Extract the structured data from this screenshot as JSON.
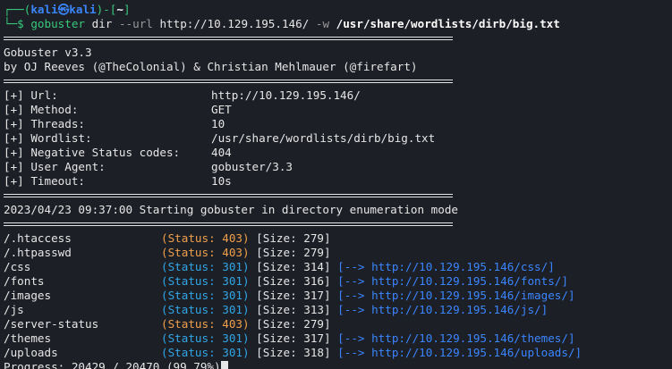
{
  "prompt": {
    "top_prefix": "┌──(",
    "user": "kali",
    "at": "㉿",
    "host": "kali",
    "mid": ")-[",
    "dir": "~",
    "close": "]",
    "bottom_prefix": "└─$",
    "cmd": "gobuster",
    "arg_dir": "dir",
    "flag_url": "--url",
    "url": "http://10.129.195.146/",
    "flag_w": "-w",
    "wordlist": "/usr/share/wordlists/dirb/big.txt"
  },
  "banner": {
    "title": "Gobuster v3.3",
    "authors": "by OJ Reeves (@TheColonial) & Christian Mehlmauer (@firefart)"
  },
  "config": [
    {
      "key": "[+] Url:",
      "value": "http://10.129.195.146/"
    },
    {
      "key": "[+] Method:",
      "value": "GET"
    },
    {
      "key": "[+] Threads:",
      "value": "10"
    },
    {
      "key": "[+] Wordlist:",
      "value": "/usr/share/wordlists/dirb/big.txt"
    },
    {
      "key": "[+] Negative Status codes:",
      "value": "404"
    },
    {
      "key": "[+] User Agent:",
      "value": "gobuster/3.3"
    },
    {
      "key": "[+] Timeout:",
      "value": "10s"
    }
  ],
  "start_message": "2023/04/23 09:37:00 Starting gobuster in directory enumeration mode",
  "results": [
    {
      "path": "/.htaccess",
      "status": "(Status: 403)",
      "size": "[Size: 279]",
      "redirect": ""
    },
    {
      "path": "/.htpasswd",
      "status": "(Status: 403)",
      "size": "[Size: 279]",
      "redirect": ""
    },
    {
      "path": "/css",
      "status": "(Status: 301)",
      "size": "[Size: 314]",
      "redirect": "[--> http://10.129.195.146/css/]"
    },
    {
      "path": "/fonts",
      "status": "(Status: 301)",
      "size": "[Size: 316]",
      "redirect": "[--> http://10.129.195.146/fonts/]"
    },
    {
      "path": "/images",
      "status": "(Status: 301)",
      "size": "[Size: 317]",
      "redirect": "[--> http://10.129.195.146/images/]"
    },
    {
      "path": "/js",
      "status": "(Status: 301)",
      "size": "[Size: 313]",
      "redirect": "[--> http://10.129.195.146/js/]"
    },
    {
      "path": "/server-status",
      "status": "(Status: 403)",
      "size": "[Size: 279]",
      "redirect": ""
    },
    {
      "path": "/themes",
      "status": "(Status: 301)",
      "size": "[Size: 317]",
      "redirect": "[--> http://10.129.195.146/themes/]"
    },
    {
      "path": "/uploads",
      "status": "(Status: 301)",
      "size": "[Size: 318]",
      "redirect": "[--> http://10.129.195.146/uploads/]"
    }
  ],
  "progress": "Progress: 20429 / 20470 (99.79%)",
  "colors": {
    "background": "#1d1f26",
    "prompt_blue": "#3a86ff",
    "status_403": "#f0a04b",
    "status_301": "#2fa7e6",
    "redirect": "#3a86ff"
  }
}
